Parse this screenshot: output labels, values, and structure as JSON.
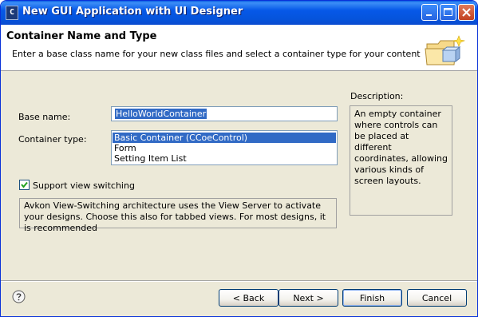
{
  "window": {
    "title": "New GUI Application with UI Designer",
    "app_icon_letter": "C"
  },
  "banner": {
    "title": "Container Name and Type",
    "description": "Enter a base class name for your new class files and select a container type for your content"
  },
  "form": {
    "base_name_label": "Base name:",
    "base_name_value": "HelloWorldContainer",
    "container_type_label": "Container type:",
    "container_types": [
      {
        "label": "Basic Container (CCoeControl)",
        "selected": true
      },
      {
        "label": "Form",
        "selected": false
      },
      {
        "label": "Setting Item List",
        "selected": false
      }
    ],
    "support_view_switching_label": "Support view switching",
    "support_view_switching_checked": true,
    "view_switching_info": "Avkon View-Switching architecture uses the View Server to activate your designs. Choose this also for tabbed views. For most designs, it is recommended"
  },
  "description": {
    "label": "Description:",
    "text": "An empty container where controls can be placed at different coordinates, allowing various kinds of screen layouts."
  },
  "buttons": {
    "back": "< Back",
    "next": "Next >",
    "finish": "Finish",
    "cancel": "Cancel"
  },
  "colors": {
    "titlebar": "#0658e8",
    "selection": "#316ac5",
    "dialog_bg": "#ece9d8"
  },
  "icons": [
    "app-icon",
    "minimize-icon",
    "maximize-icon",
    "close-icon",
    "wizard-folder-icon",
    "checkmark-icon",
    "help-icon"
  ]
}
